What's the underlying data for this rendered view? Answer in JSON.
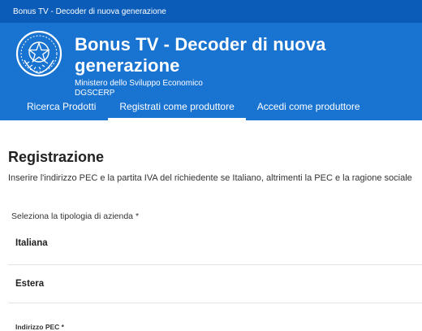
{
  "topbar": {
    "title": "Bonus TV - Decoder di nuova generazione"
  },
  "header": {
    "title": "Bonus TV - Decoder di nuova generazione",
    "ministry": "Ministero dello Sviluppo Economico",
    "department": "DGSCERP",
    "emblem_icon": "italian-republic-emblem-icon"
  },
  "nav": {
    "items": [
      {
        "label": "Ricerca Prodotti",
        "active": false
      },
      {
        "label": "Registrati come produttore",
        "active": true
      },
      {
        "label": "Accedi come produttore",
        "active": false
      }
    ]
  },
  "main": {
    "title": "Registrazione",
    "instructions": "Inserire l'indirizzo PEC e la partita IVA del richiedente se Italiano, altrimenti la PEC e la ragione sociale",
    "company_type_label": "Seleziona la tipologia di azienda *",
    "company_types": [
      {
        "label": "Italiana"
      },
      {
        "label": "Estera"
      }
    ],
    "pec_label": "Indirizzo PEC *"
  },
  "colors": {
    "topbar": "#0a5cb8",
    "header": "#1973d1",
    "text": "#1a1a1a"
  }
}
